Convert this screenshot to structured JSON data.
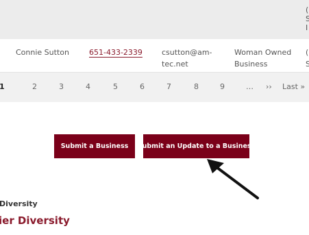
{
  "table": {
    "header_cut": [
      "(",
      "S",
      "I"
    ],
    "row": {
      "name": "Connie Sutton",
      "phone": "651-433-2339",
      "email_line1": "csutton@am-",
      "email_line2": "tec.net",
      "category_line1": "Woman Owned",
      "category_line2": "Business",
      "cut_line1": "(",
      "cut_line2": "S"
    }
  },
  "pager": {
    "pages": [
      "1",
      "2",
      "3",
      "4",
      "5",
      "6",
      "7",
      "8",
      "9",
      "…",
      "››",
      "Last »"
    ],
    "current": "1"
  },
  "buttons": {
    "submit_business": "Submit a Business",
    "submit_update": "Submit an Update to a Business"
  },
  "footer": {
    "breadcrumb": "Diversity",
    "heading": "ier Diversity"
  },
  "colors": {
    "brand": "#7a0019",
    "link": "#8a1a2c",
    "header_bg": "#ececec",
    "pager_bg": "#f1f1f1"
  }
}
